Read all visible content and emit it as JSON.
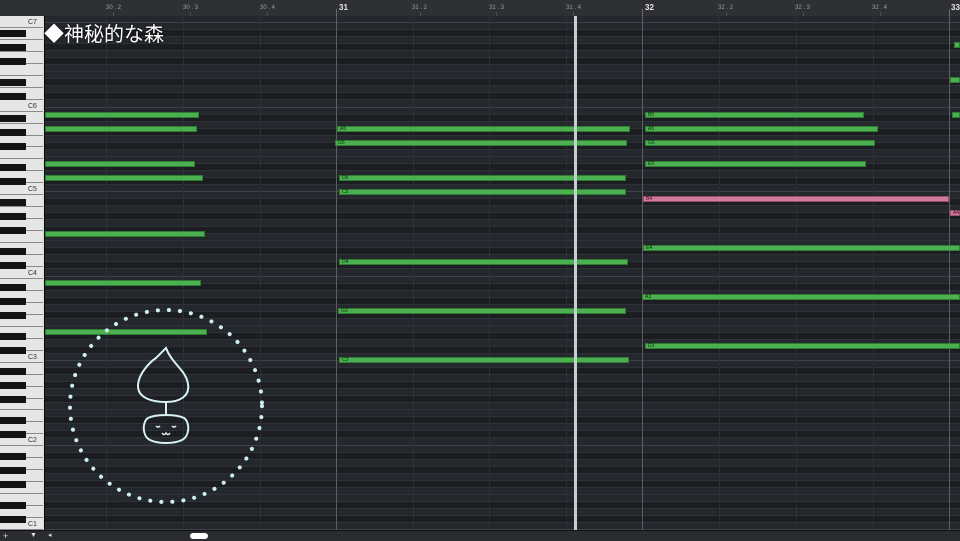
{
  "title": "◆神秘的な森",
  "ruler": {
    "bars": [
      {
        "label": "31"
      },
      {
        "label": "32"
      },
      {
        "label": "33"
      }
    ],
    "beats": [
      "30 . 2",
      "30 . 3",
      "30 . 4",
      "31 . 2",
      "31 . 3",
      "31 . 4",
      "32 . 2",
      "32 . 3",
      "32 . 4"
    ]
  },
  "keyboard": {
    "c_labels": [
      "C7",
      "C6",
      "C5",
      "C4",
      "C3",
      "C2",
      "C1"
    ]
  },
  "notes": [
    {
      "label": "",
      "color": "green"
    },
    {
      "label": "",
      "color": "green"
    },
    {
      "label": "",
      "color": "green"
    },
    {
      "label": "",
      "color": "green"
    },
    {
      "label": "",
      "color": "green"
    },
    {
      "label": "",
      "color": "green"
    },
    {
      "label": "",
      "color": "green"
    },
    {
      "label": "A5",
      "color": "green"
    },
    {
      "label": "G5",
      "color": "green"
    },
    {
      "label": "D5",
      "color": "green"
    },
    {
      "label": "C5",
      "color": "green"
    },
    {
      "label": "D4",
      "color": "green"
    },
    {
      "label": "G3",
      "color": "green"
    },
    {
      "label": "C3",
      "color": "green"
    },
    {
      "label": "B5",
      "color": "green"
    },
    {
      "label": "A5",
      "color": "green"
    },
    {
      "label": "G5",
      "color": "green"
    },
    {
      "label": "E5",
      "color": "green"
    },
    {
      "label": "B4",
      "color": "pink"
    },
    {
      "label": "E4",
      "color": "green"
    },
    {
      "label": "A3",
      "color": "green"
    },
    {
      "label": "D3",
      "color": "green"
    },
    {
      "label": "",
      "color": "green"
    },
    {
      "label": "",
      "color": "green"
    },
    {
      "label": "",
      "color": "green"
    },
    {
      "label": "A4",
      "color": "pink"
    }
  ],
  "statusbar": {
    "plus": "+",
    "down": "▼",
    "left": "◂"
  },
  "colors": {
    "note_green": "#4caf50",
    "note_pink": "#d07a99",
    "background": "#22252a",
    "playhead": "#c8cdd4"
  }
}
